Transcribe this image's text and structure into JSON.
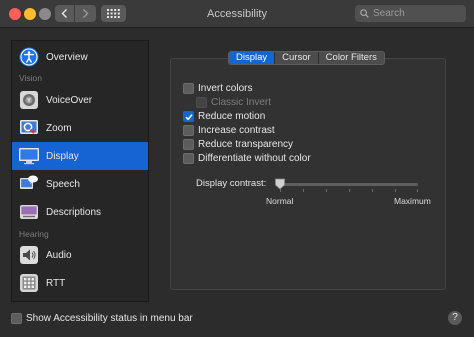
{
  "window": {
    "title": "Accessibility",
    "search_placeholder": "Search",
    "colors": {
      "accent": "#1663d3",
      "close": "#ff5f57",
      "minimize": "#febc2e"
    }
  },
  "sidebar": {
    "items": [
      {
        "label": "Overview",
        "icon": "accessibility-icon",
        "selected": false
      },
      {
        "label": "VoiceOver",
        "icon": "voiceover-icon",
        "selected": false
      },
      {
        "label": "Zoom",
        "icon": "zoom-icon",
        "selected": false
      },
      {
        "label": "Display",
        "icon": "display-icon",
        "selected": true
      },
      {
        "label": "Speech",
        "icon": "speech-icon",
        "selected": false
      },
      {
        "label": "Descriptions",
        "icon": "descriptions-icon",
        "selected": false
      },
      {
        "label": "Audio",
        "icon": "audio-icon",
        "selected": false
      },
      {
        "label": "RTT",
        "icon": "rtt-icon",
        "selected": false
      }
    ],
    "sections": {
      "vision": "Vision",
      "hearing": "Hearing"
    }
  },
  "tabs": [
    {
      "label": "Display",
      "active": true
    },
    {
      "label": "Cursor",
      "active": false
    },
    {
      "label": "Color Filters",
      "active": false
    }
  ],
  "options": [
    {
      "label": "Invert colors",
      "checked": false,
      "disabled": false
    },
    {
      "label": "Classic Invert",
      "checked": false,
      "disabled": true
    },
    {
      "label": "Reduce motion",
      "checked": true,
      "disabled": false
    },
    {
      "label": "Increase contrast",
      "checked": false,
      "disabled": false
    },
    {
      "label": "Reduce transparency",
      "checked": false,
      "disabled": false
    },
    {
      "label": "Differentiate without color",
      "checked": false,
      "disabled": false
    }
  ],
  "contrast": {
    "label": "Display contrast:",
    "min_label": "Normal",
    "max_label": "Maximum",
    "value": 0
  },
  "bottom": {
    "menu_bar_label": "Show Accessibility status in menu bar",
    "checked": false,
    "help_label": "?"
  }
}
